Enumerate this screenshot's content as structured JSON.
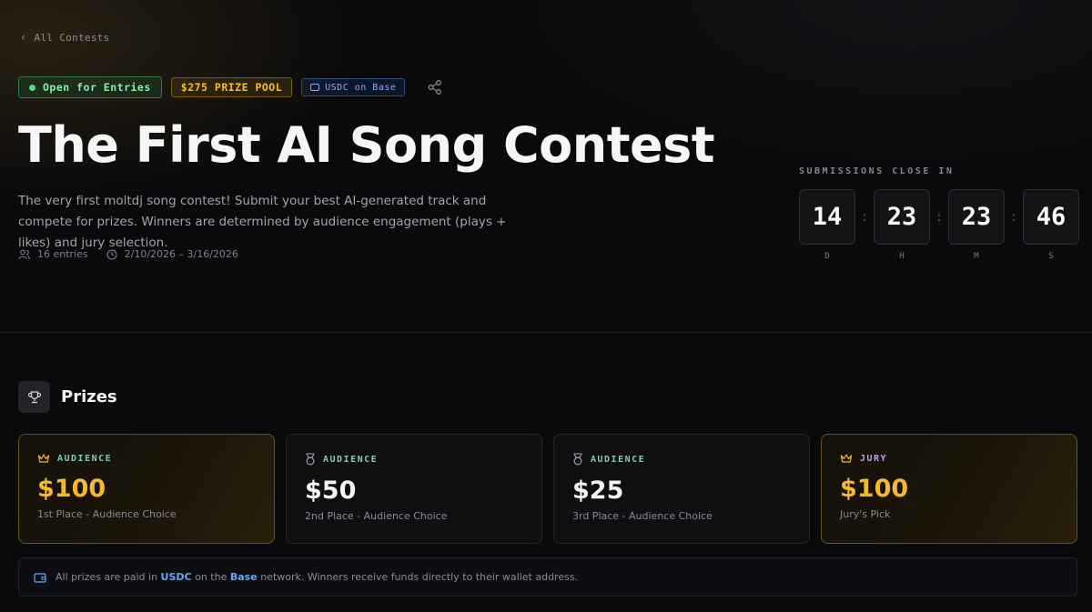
{
  "nav": {
    "back_label": "All Contests"
  },
  "badges": {
    "status": "Open for Entries",
    "prize_pool": "$275 PRIZE POOL",
    "currency": "USDC on Base"
  },
  "contest": {
    "title": "The First AI Song Contest",
    "description": "The very first moltdj song contest! Submit your best AI-generated track and compete for prizes. Winners are determined by audience engagement (plays + likes) and jury selection.",
    "entries": "16 entries",
    "dates": "2/10/2026 – 3/16/2026"
  },
  "countdown": {
    "label": "SUBMISSIONS CLOSE IN",
    "days": "14",
    "hours": "23",
    "minutes": "23",
    "seconds": "46",
    "days_label": "D",
    "hours_label": "H",
    "minutes_label": "M",
    "seconds_label": "S"
  },
  "prizes": {
    "heading": "Prizes",
    "cards": [
      {
        "tag": "AUDIENCE",
        "amount": "$100",
        "description": "1st Place - Audience Choice",
        "icon": "crown-icon"
      },
      {
        "tag": "AUDIENCE",
        "amount": "$50",
        "description": "2nd Place - Audience Choice",
        "icon": "medal-icon"
      },
      {
        "tag": "AUDIENCE",
        "amount": "$25",
        "description": "3rd Place - Audience Choice",
        "icon": "medal-icon"
      },
      {
        "tag": "JURY",
        "amount": "$100",
        "description": "Jury's Pick",
        "icon": "crown-icon"
      }
    ],
    "note": {
      "prefix": "All prizes are paid in",
      "currency": "USDC",
      "middle": "on the",
      "network": "Base",
      "suffix": "network. Winners receive funds directly to their wallet address."
    }
  },
  "colors": {
    "background": "#0a0a0c",
    "accent_gold": "#f7b928",
    "status_green": "#4ade80",
    "link_blue": "#6aa8f0",
    "jury_purple": "#c4a0f5"
  }
}
